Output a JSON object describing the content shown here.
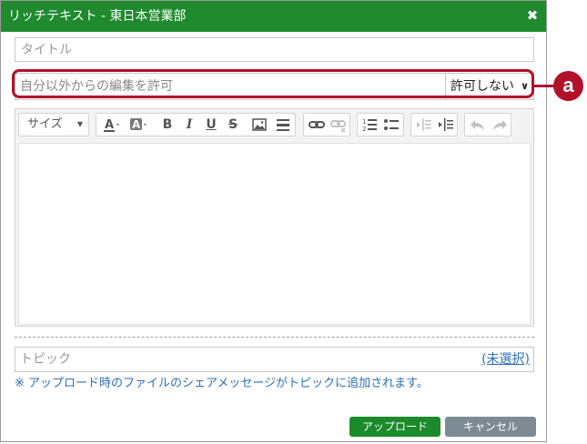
{
  "window": {
    "title": "リッチテキスト - 東日本営業部"
  },
  "title_field": {
    "placeholder": "タイトル"
  },
  "permission": {
    "label": "自分以外からの編集を許可",
    "selected": "許可しない"
  },
  "callout": {
    "label": "a"
  },
  "toolbar": {
    "size_label": "サイズ",
    "bold": "B",
    "italic": "I",
    "underline": "U",
    "strike": "S",
    "font_color_glyph": "A",
    "bg_color_glyph": "A"
  },
  "topic": {
    "label": "トピック",
    "link": "(未選択)"
  },
  "note": "※ アップロード時のファイルのシェアメッセージがトピックに追加されます。",
  "buttons": {
    "upload": "アップロード",
    "cancel": "キャンセル"
  },
  "colors": {
    "titlebar": "#1f8a2e",
    "callout": "#b3102a",
    "link": "#2f6fb8",
    "upload": "#1a8a2a",
    "cancel": "#7d8a94"
  }
}
